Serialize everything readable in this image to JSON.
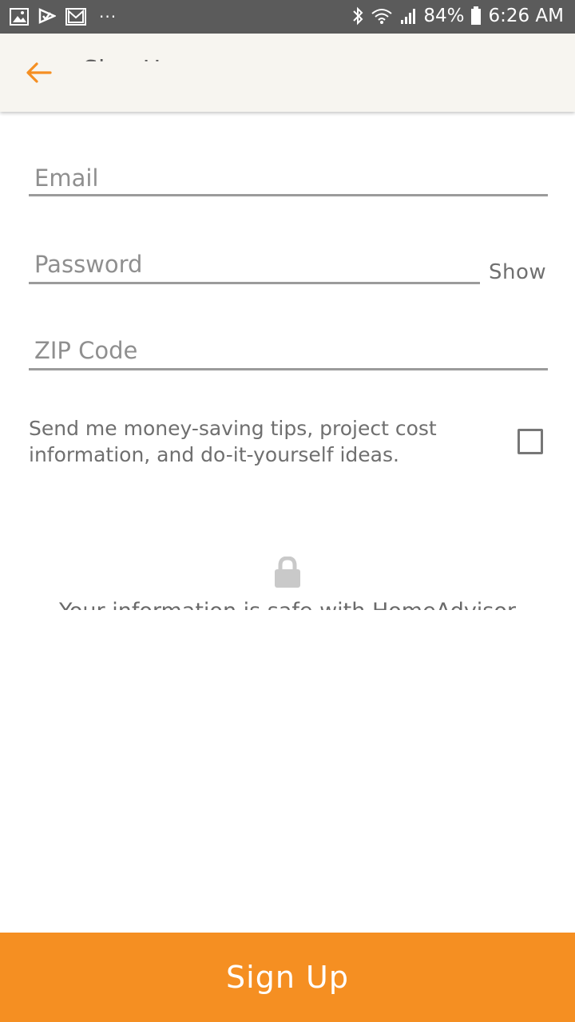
{
  "status_bar": {
    "battery": "84%",
    "time": "6:26 AM",
    "left_icons": [
      "gallery-icon",
      "check-flag-icon",
      "gmail-icon"
    ],
    "overflow": "···"
  },
  "app_bar": {
    "title": "Sign Up",
    "back_icon": "arrow-left-icon"
  },
  "form": {
    "email_placeholder": "Email",
    "password_placeholder": "Password",
    "show_label": "Show",
    "zip_placeholder": "ZIP Code",
    "tips_text": "Send me money-saving tips, project cost information, and do-it-yourself ideas.",
    "tips_checked": false
  },
  "security": {
    "icon": "lock-icon",
    "text": "Your information is safe with HomeAdvisor"
  },
  "footer": {
    "signup_label": "Sign Up"
  },
  "colors": {
    "accent": "#f58f22",
    "appbar_bg": "#f7f5f0",
    "status_bar_bg": "#5b5b5b"
  }
}
